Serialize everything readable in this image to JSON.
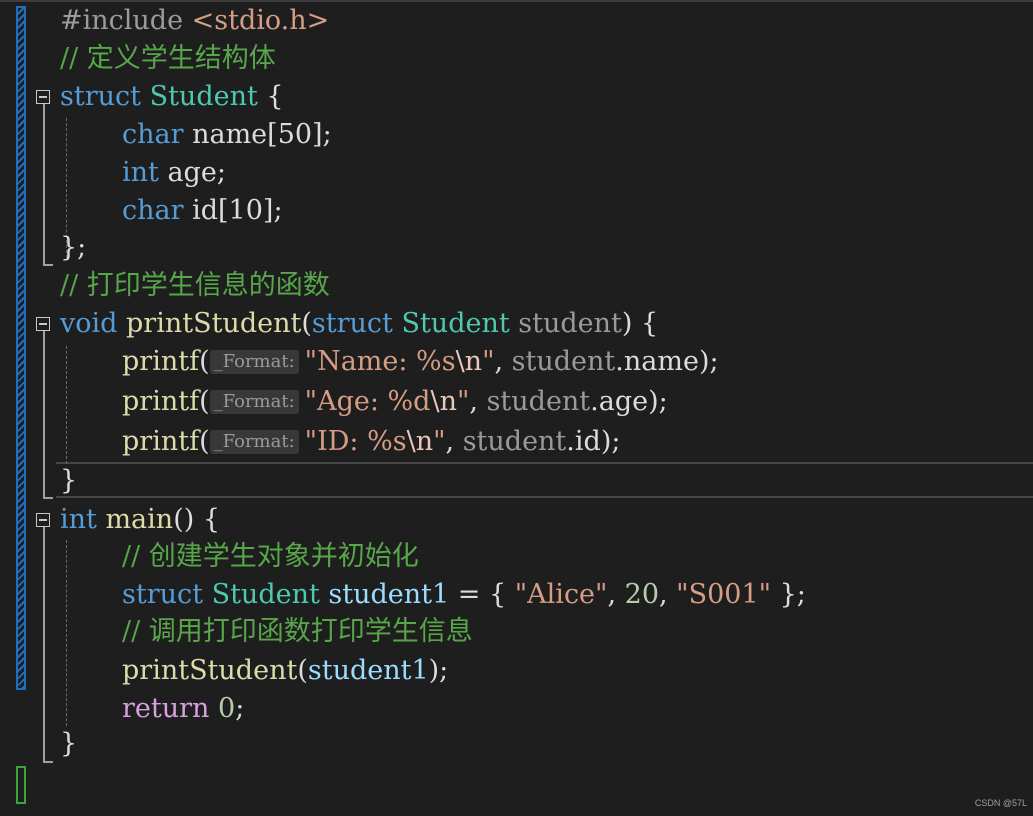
{
  "editor": {
    "language": "C",
    "colors": {
      "background": "#1e1e1e",
      "keyword": "#569cd6",
      "type": "#4ec9b0",
      "comment": "#57a64a",
      "string": "#d69d85",
      "function": "#dcdcaa",
      "control_keyword": "#d8a0df",
      "change_bar": "#1e6fc0"
    }
  },
  "code": {
    "l1_include": "#include ",
    "l1_header": "<stdio.h>",
    "l2_comment": "// 定义学生结构体",
    "l3_struct": "struct",
    "l3_type": "Student",
    "l3_brace": " {",
    "l4_char": "char",
    "l4_rest": " name[50];",
    "l5_int": "int",
    "l5_rest": " age;",
    "l6_char": "char",
    "l6_rest": " id[10];",
    "l7_close": "};",
    "l8_comment": "// 打印学生信息的函数",
    "l9_void": "void",
    "l9_fn": " printStudent",
    "l9_paren": "(",
    "l9_struct": "struct",
    "l9_type": "Student",
    "l9_param": " student",
    "l9_end": ") {",
    "printf": "printf",
    "open_paren": "(",
    "hint_format": "_Format:",
    "l10_str_a": "\"Name: %s",
    "l10_esc": "\\n",
    "l10_str_b": "\"",
    "l10_comma": ", ",
    "l10_obj": "student",
    "l10_field": ".name",
    "l10_end": ");",
    "l11_str_a": "\"Age: %d",
    "l11_esc": "\\n",
    "l11_str_b": "\"",
    "l11_comma": ", ",
    "l11_obj": "student",
    "l11_field": ".age",
    "l11_end": ");",
    "l12_str_a": "\"ID: %s",
    "l12_esc": "\\n",
    "l12_str_b": "\"",
    "l12_comma": ", ",
    "l12_obj": "student",
    "l12_field": ".id",
    "l12_end": ");",
    "l13_close": "}",
    "l14_int": "int",
    "l14_fn": " main",
    "l14_end": "() {",
    "l15_comment": "// 创建学生对象并初始化",
    "l16_struct": "struct",
    "l16_type": "Student",
    "l16_var": " student1",
    "l16_eq": " = { ",
    "l16_str1": "\"Alice\"",
    "l16_c1": ", ",
    "l16_num": "20",
    "l16_c2": ", ",
    "l16_str2": "\"S001\"",
    "l16_end": " };",
    "l17_comment": "// 调用打印函数打印学生信息",
    "l18_fn": "printStudent",
    "l18_open": "(",
    "l18_var": "student1",
    "l18_end": ");",
    "l19_return": "return",
    "l19_num": " 0",
    "l19_end": ";",
    "l20_close": "}"
  },
  "watermark": "CSDN @57L"
}
